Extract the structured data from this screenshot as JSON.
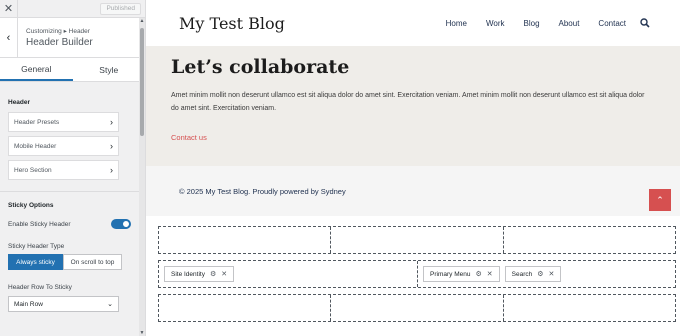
{
  "topbar": {
    "close_icon": "close-icon",
    "published_label": "Published"
  },
  "section": {
    "breadcrumb": "Customizing ▸ Header",
    "title": "Header Builder",
    "back_icon": "chevron-left-icon"
  },
  "tabs": [
    {
      "label": "General",
      "active": true
    },
    {
      "label": "Style",
      "active": false
    }
  ],
  "panel": {
    "header_label": "Header",
    "items": [
      {
        "label": "Header Presets"
      },
      {
        "label": "Mobile Header"
      },
      {
        "label": "Hero Section"
      }
    ],
    "sticky_label": "Sticky Options",
    "enable_sticky_label": "Enable Sticky Header",
    "enable_sticky_on": true,
    "sticky_type_label": "Sticky Header Type",
    "sticky_type_options": [
      "Always sticky",
      "On scroll to top"
    ],
    "sticky_type_selected": "Always sticky",
    "row_to_sticky_label": "Header Row To Sticky",
    "row_to_sticky_value": "Main Row"
  },
  "site": {
    "title": "My Test Blog",
    "menu": [
      "Home",
      "Work",
      "Blog",
      "About",
      "Contact"
    ],
    "hero_title": "Let’s collaborate",
    "hero_text": "Amet minim mollit non deserunt ullamco est sit aliqua dolor do amet sint. Exercitation veniam. Amet minim mollit non deserunt ullamco est sit aliqua dolor do amet sint. Exercitation veniam.",
    "hero_cta": "Contact us",
    "footer_text": "© 2025 My Test Blog. Proudly powered by Sydney",
    "accent": "#d65050"
  },
  "builder": {
    "main_row_left": [
      "Site Identity"
    ],
    "main_row_right": [
      "Primary Menu",
      "Search"
    ]
  },
  "colors": {
    "primary": "#2271b1",
    "accent": "#d65050"
  }
}
